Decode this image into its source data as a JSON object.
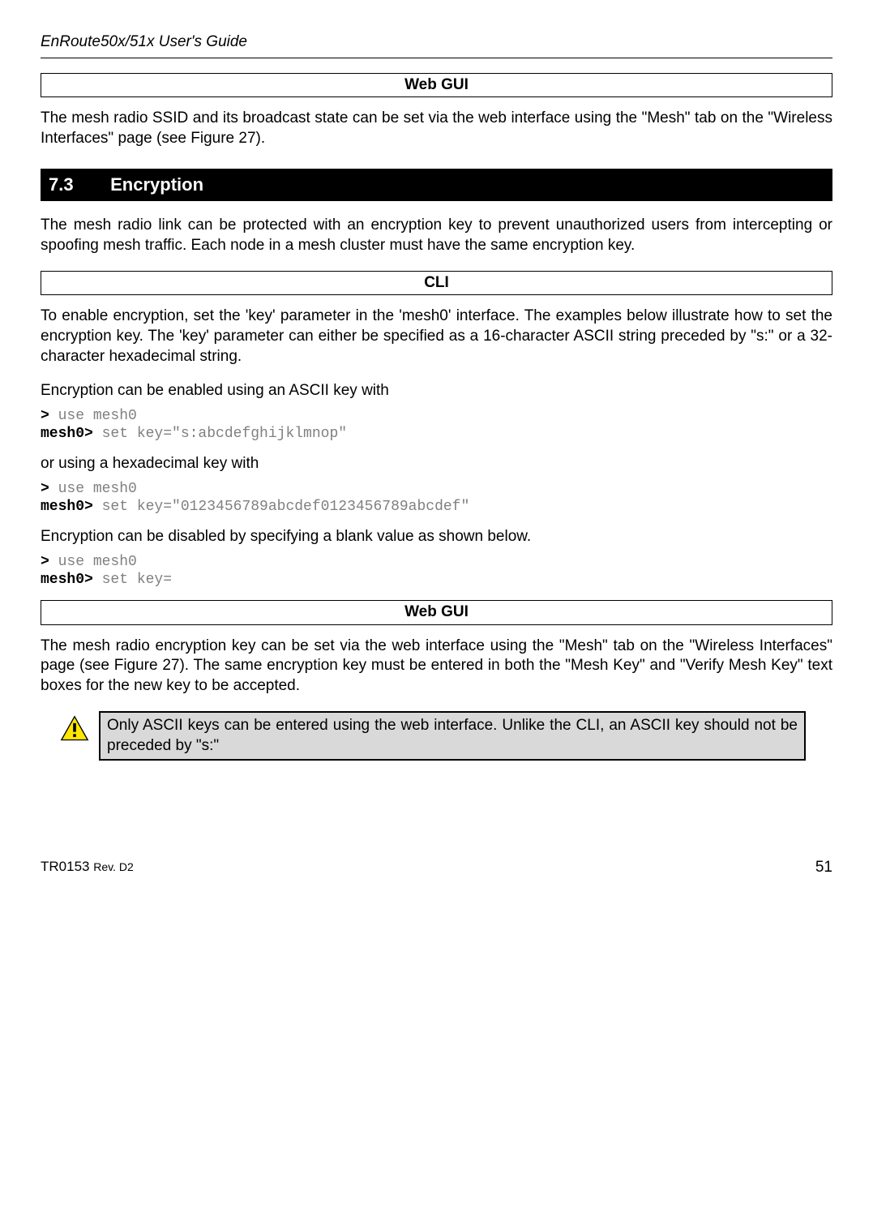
{
  "header": {
    "title": "EnRoute50x/51x User's Guide"
  },
  "boxes": {
    "webgui1": "Web GUI",
    "cli": "CLI",
    "webgui2": "Web GUI"
  },
  "paragraphs": {
    "p1": "The mesh radio SSID and its broadcast state can be set via the web interface using the \"Mesh\" tab on the \"Wireless Interfaces\" page (see Figure 27).",
    "p2": "The mesh radio link can be protected with an encryption key to prevent unauthorized users from intercepting or spoofing mesh traffic. Each node in a mesh cluster must have the same encryption key.",
    "p3": "To enable encryption, set the 'key' parameter in the 'mesh0' interface. The examples below illustrate how to set the encryption key. The 'key' parameter can either be specified as a 16-character ASCII string preceded by \"s:\" or a 32-character hexadecimal string.",
    "p4": "Encryption can be enabled using an ASCII key with",
    "p5": "or using a hexadecimal key with",
    "p6": "Encryption can be disabled by specifying a blank value as shown below.",
    "p7": "The mesh radio encryption key can be set via the web interface using the \"Mesh\" tab on the \"Wireless Interfaces\" page (see Figure 27). The same encryption key must be entered in both the \"Mesh Key\" and \"Verify Mesh Key\" text boxes for the new key to be accepted."
  },
  "section": {
    "num": "7.3",
    "title": "Encryption"
  },
  "cli": {
    "block1": {
      "prompt1": ">",
      "cmd1": " use mesh0",
      "prompt2": "mesh0>",
      "cmd2": " set key=\"s:abcdefghijklmnop\""
    },
    "block2": {
      "prompt1": ">",
      "cmd1": " use mesh0",
      "prompt2": "mesh0>",
      "cmd2": " set key=\"0123456789abcdef0123456789abcdef\""
    },
    "block3": {
      "prompt1": ">",
      "cmd1": " use mesh0",
      "prompt2": "mesh0>",
      "cmd2": " set key="
    }
  },
  "note": {
    "text": "Only ASCII keys can be entered using the web interface. Unlike the CLI, an ASCII key should not be preceded by \"s:\""
  },
  "footer": {
    "doc": "TR0153 ",
    "rev": "Rev. D2",
    "page": "51"
  }
}
